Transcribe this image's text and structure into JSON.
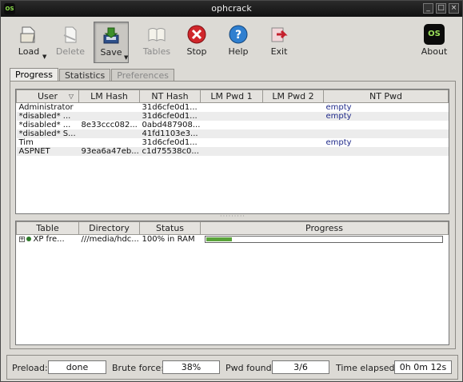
{
  "window": {
    "title": "ophcrack",
    "icon_text": "OS",
    "controls": [
      "_",
      "□",
      "×"
    ]
  },
  "toolbar": {
    "load": "Load",
    "delete": "Delete",
    "save": "Save",
    "tables": "Tables",
    "stop": "Stop",
    "help": "Help",
    "exit": "Exit",
    "about": "About",
    "about_logo": "OS"
  },
  "tabs": [
    "Progress",
    "Statistics",
    "Preferences"
  ],
  "hashes": {
    "columns": [
      "User",
      "LM Hash",
      "NT Hash",
      "LM Pwd 1",
      "LM Pwd 2",
      "NT Pwd"
    ],
    "rows": [
      [
        "Administrator",
        "",
        "31d6cfe0d1...",
        "",
        "",
        "empty"
      ],
      [
        "*disabled* ...",
        "",
        "31d6cfe0d1...",
        "",
        "",
        "empty"
      ],
      [
        "*disabled* ...",
        "8e33ccc082...",
        "0abd487908...",
        "",
        "",
        ""
      ],
      [
        "*disabled* S...",
        "",
        "41fd1103e3...",
        "",
        "",
        ""
      ],
      [
        "Tim",
        "",
        "31d6cfe0d1...",
        "",
        "",
        "empty"
      ],
      [
        "ASPNET",
        "93ea6a47eb...",
        "c1d75538c0...",
        "",
        "",
        ""
      ]
    ]
  },
  "tables_list": {
    "columns": [
      "Table",
      "Directory",
      "Status",
      "Progress"
    ],
    "rows": [
      {
        "expander": "+",
        "table": "XP fre...",
        "directory": "///media/hdc...",
        "status": "100% in RAM",
        "progress": 0.11
      }
    ]
  },
  "status": {
    "preload_label": "Preload:",
    "preload_value": "done",
    "brute_label": "Brute force:",
    "brute_value": "38%",
    "pwd_label": "Pwd found:",
    "pwd_value": "3/6",
    "time_label": "Time elapsed:",
    "time_value": "0h 0m 12s"
  },
  "colors": {
    "progress_fill": "#5aa33b",
    "empty_text": "#1f2a8a"
  }
}
